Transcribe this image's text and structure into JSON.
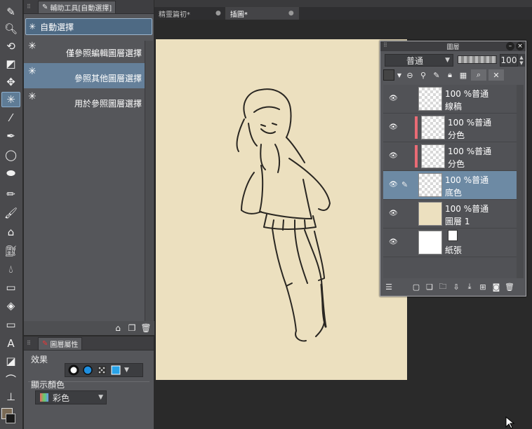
{
  "subtool_panel": {
    "tab_label": "輔助工具[自動選擇]",
    "header_label": "自動選擇",
    "items": [
      {
        "label": "僅參照編輯圖層選擇"
      },
      {
        "label": "參照其他圖層選擇"
      },
      {
        "label": "用於參照圖層選擇"
      }
    ]
  },
  "property_panel": {
    "tab_label": "圖層屬性",
    "effects_label": "效果",
    "display_color_label": "顯示顏色",
    "display_color_value": "彩色"
  },
  "document_tabs": [
    {
      "label": "精靈篇初*"
    },
    {
      "label": "插圖*"
    }
  ],
  "layer_panel": {
    "title": "圖層",
    "blend_mode": "普通",
    "opacity": "100",
    "layers": [
      {
        "line1": "100 %普通",
        "line2": "線稿"
      },
      {
        "line1": "100 %普通",
        "line2": "分色"
      },
      {
        "line1": "100 %普通",
        "line2": "分色"
      },
      {
        "line1": "100 %普通",
        "line2": "底色"
      },
      {
        "line1": "100 %普通",
        "line2": "圖層 1"
      },
      {
        "line1": "",
        "line2": "紙張"
      }
    ]
  },
  "colors": {
    "paper": "#ece0bf",
    "accent": "#6d8aa4",
    "tag_red": "#e96b75"
  }
}
